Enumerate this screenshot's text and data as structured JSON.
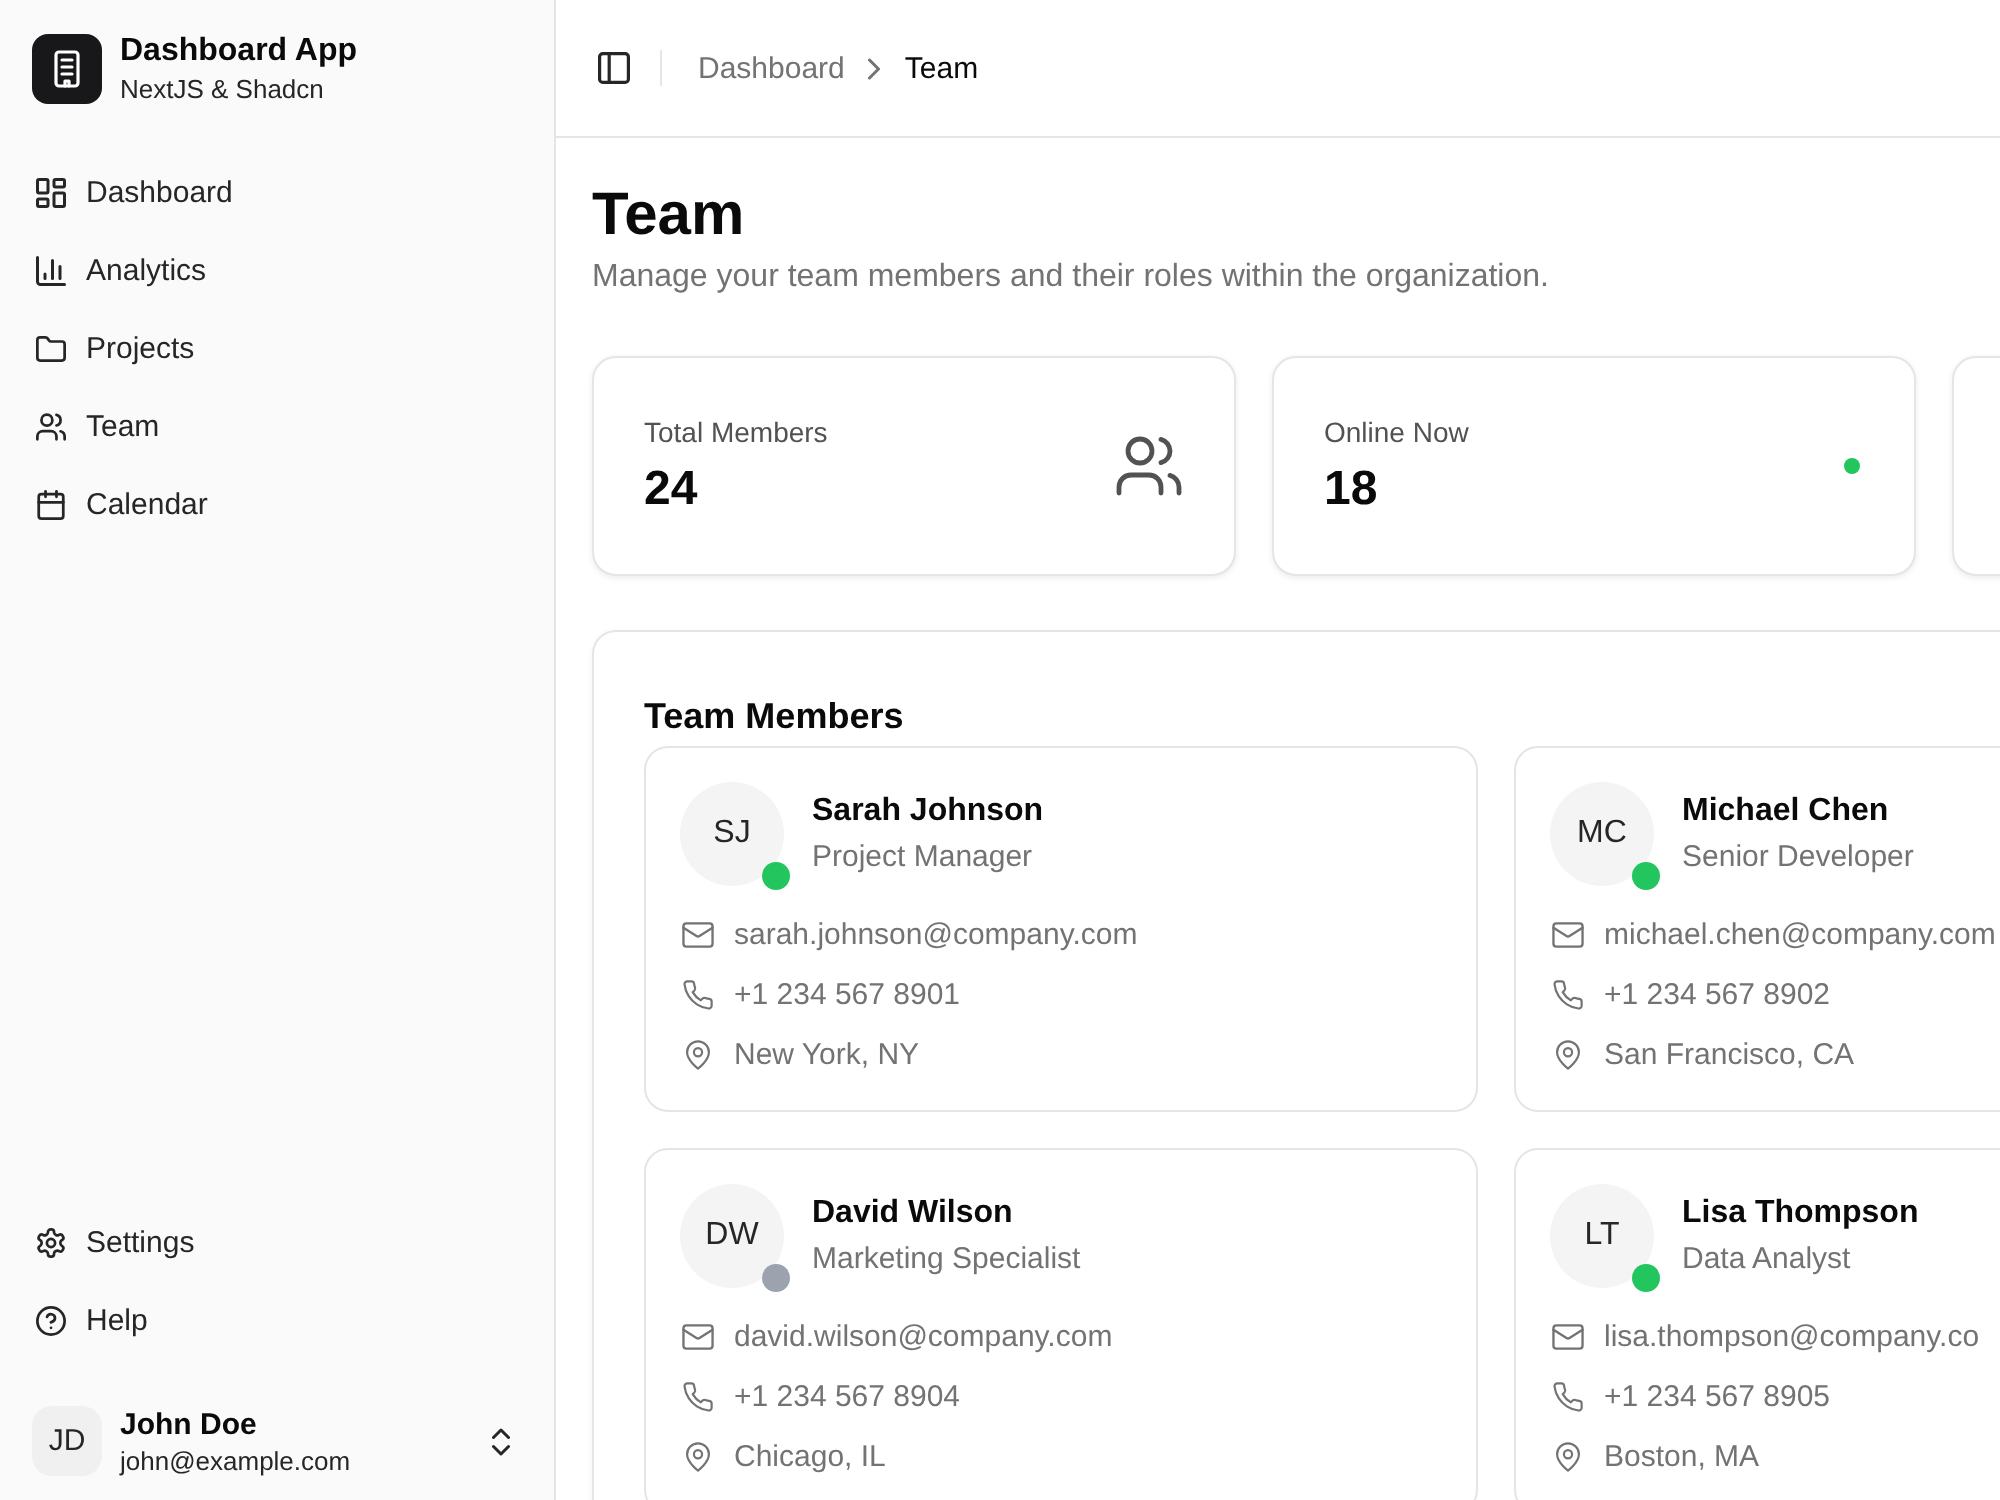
{
  "sidebar": {
    "brand": {
      "name": "Dashboard App",
      "subtitle": "NextJS & Shadcn"
    },
    "nav": [
      {
        "label": "Dashboard",
        "selected": false
      },
      {
        "label": "Analytics",
        "selected": false
      },
      {
        "label": "Projects",
        "selected": false
      },
      {
        "label": "Team",
        "selected": false
      },
      {
        "label": "Calendar",
        "selected": false
      }
    ],
    "footer_nav": [
      {
        "label": "Settings"
      },
      {
        "label": "Help"
      }
    ],
    "user": {
      "initials": "JD",
      "name": "John Doe",
      "email": "john@example.com"
    }
  },
  "header": {
    "breadcrumbs": [
      {
        "label": "Dashboard",
        "current": false
      },
      {
        "label": "Team",
        "current": true
      }
    ]
  },
  "page": {
    "title": "Team",
    "description": "Manage your team members and their roles within the organization."
  },
  "stats": [
    {
      "kind": "users",
      "label": "Total Members",
      "value": "24"
    },
    {
      "kind": "dot",
      "label": "Online Now",
      "value": "18"
    }
  ],
  "team": {
    "title": "Team Members",
    "members": [
      {
        "initials": "SJ",
        "name": "Sarah Johnson",
        "role": "Project Manager",
        "email": "sarah.johnson@company.com",
        "phone": "+1 234 567 8901",
        "location": "New York, NY",
        "color": "#22c55e"
      },
      {
        "initials": "MC",
        "name": "Michael Chen",
        "role": "Senior Developer",
        "email": "michael.chen@company.com",
        "phone": "+1 234 567 8902",
        "location": "San Francisco, CA",
        "color": "#22c55e"
      },
      {
        "initials": "DW",
        "name": "David Wilson",
        "role": "Marketing Specialist",
        "email": "david.wilson@company.com",
        "phone": "+1 234 567 8904",
        "location": "Chicago, IL",
        "color": "#9ca3af"
      },
      {
        "initials": "LT",
        "name": "Lisa Thompson",
        "role": "Data Analyst",
        "email": "lisa.thompson@company.co",
        "phone": "+1 234 567 8905",
        "location": "Boston, MA",
        "color": "#22c55e"
      }
    ]
  }
}
